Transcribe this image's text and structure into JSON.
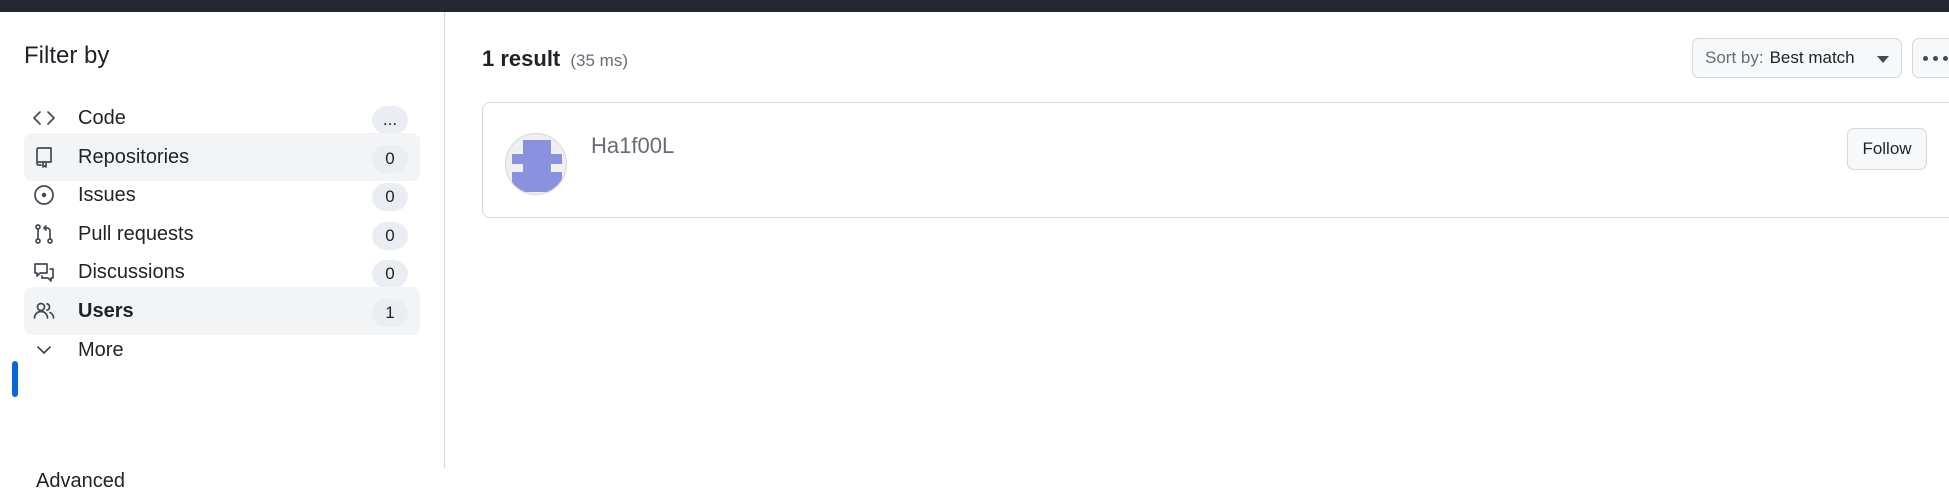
{
  "sidebar": {
    "title": "Filter by",
    "items": [
      {
        "label": "Code",
        "count": "...",
        "icon": "code-icon"
      },
      {
        "label": "Repositories",
        "count": "0",
        "icon": "repo-icon"
      },
      {
        "label": "Issues",
        "count": "0",
        "icon": "issue-icon"
      },
      {
        "label": "Pull requests",
        "count": "0",
        "icon": "pull-request-icon"
      },
      {
        "label": "Discussions",
        "count": "0",
        "icon": "discussion-icon"
      },
      {
        "label": "Users",
        "count": "1",
        "icon": "people-icon",
        "selected": true
      },
      {
        "label": "More",
        "icon": "chevron-down-icon"
      }
    ],
    "cut_off_text": "Advanced"
  },
  "results": {
    "count_label": "1 result",
    "time_label": "(35 ms)"
  },
  "sort": {
    "prefix": "Sort by:",
    "value": "Best match"
  },
  "user_result": {
    "username": "Ha1f00L",
    "follow_label": "Follow",
    "avatar_color": "#8a92e0"
  },
  "colors": {
    "accent": "#0969da",
    "topbar": "#24292f"
  }
}
